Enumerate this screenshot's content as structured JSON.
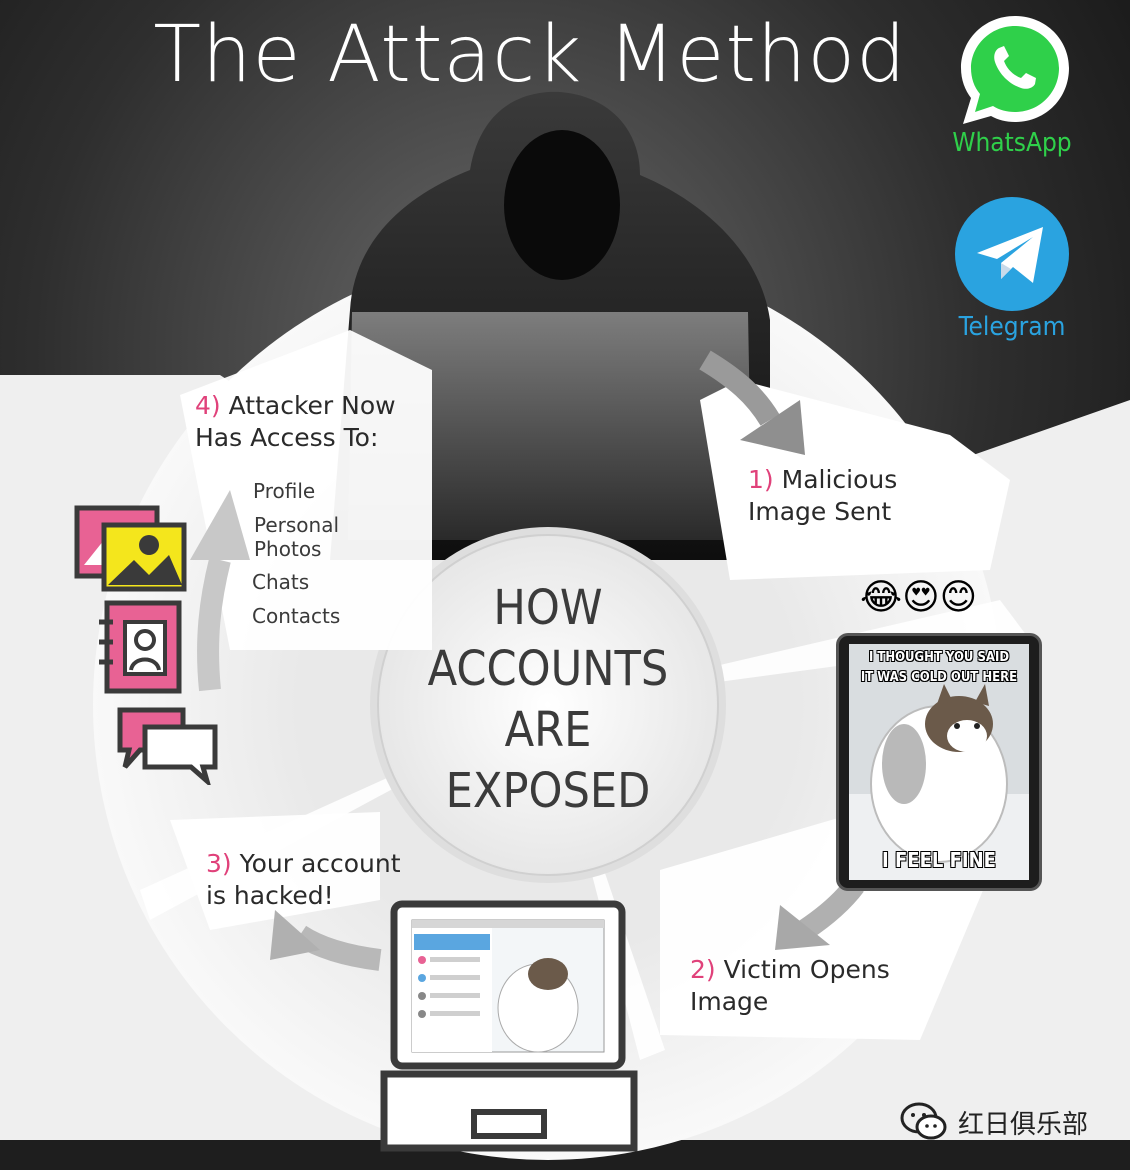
{
  "title": "The Attack Method",
  "apps": [
    {
      "name": "WhatsApp",
      "color": "#2fd04a",
      "icon": "whatsapp-icon"
    },
    {
      "name": "Telegram",
      "color": "#2aa3e0",
      "icon": "telegram-icon"
    }
  ],
  "center": {
    "lines": [
      "HOW",
      "ACCOUNTS",
      "ARE",
      "EXPOSED"
    ]
  },
  "steps": [
    {
      "num": "1)",
      "lines": [
        "Malicious",
        "Image Sent"
      ]
    },
    {
      "num": "2)",
      "lines": [
        "Victim Opens",
        "Image"
      ]
    },
    {
      "num": "3)",
      "lines": [
        "Your account",
        "is hacked!"
      ]
    },
    {
      "num": "4)",
      "lines": [
        "Attacker Now",
        "Has Access To:"
      ]
    }
  ],
  "access_items": [
    "Profile",
    "Personal\nPhotos",
    "Chats",
    "Contacts"
  ],
  "meme": {
    "top_lines": [
      "I THOUGHT YOU SAID",
      "IT WAS COLD OUT HERE"
    ],
    "bottom": "I FEEL FINE"
  },
  "emojis": [
    "😂",
    "😍",
    "😊"
  ],
  "watermark": "红日俱乐部",
  "colors": {
    "accent": "#e0417a",
    "icon_yellow": "#f4e61c",
    "icon_pink": "#e86294"
  }
}
